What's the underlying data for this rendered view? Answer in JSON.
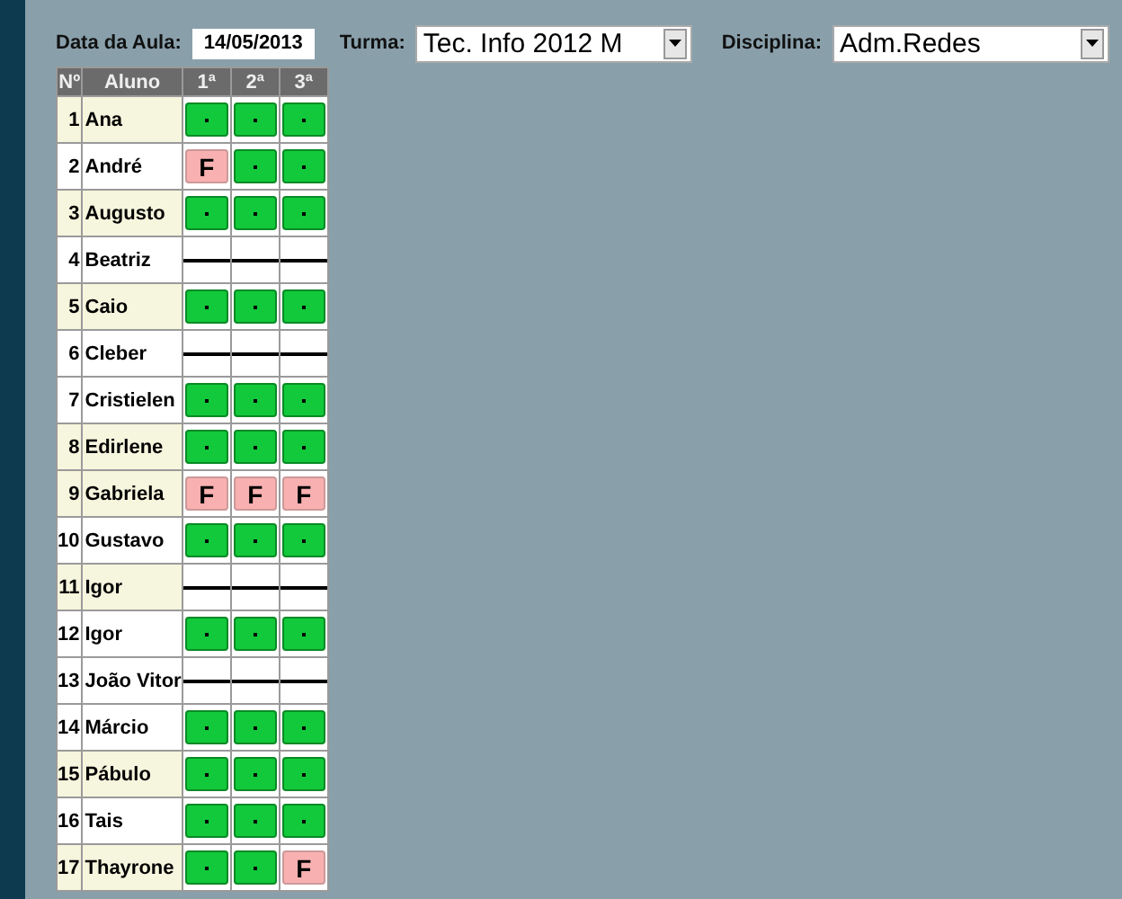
{
  "header": {
    "date_label": "Data da Aula:",
    "date_value": "14/05/2013",
    "class_label": "Turma:",
    "class_value": "Tec. Info 2012 M",
    "subject_label": "Disciplina:",
    "subject_value": "Adm.Redes"
  },
  "table": {
    "columns": [
      "Nº",
      "Aluno",
      "1ª",
      "2ª",
      "3ª"
    ],
    "rows": [
      {
        "number": "1",
        "name": "Ana",
        "shaded": true,
        "marks": [
          {
            "kind": "present"
          },
          {
            "kind": "present"
          },
          {
            "kind": "present"
          }
        ]
      },
      {
        "number": "2",
        "name": "André",
        "shaded": false,
        "marks": [
          {
            "kind": "absent",
            "label": "F"
          },
          {
            "kind": "present"
          },
          {
            "kind": "present"
          }
        ]
      },
      {
        "number": "3",
        "name": "Augusto",
        "shaded": true,
        "marks": [
          {
            "kind": "present"
          },
          {
            "kind": "present"
          },
          {
            "kind": "present"
          }
        ]
      },
      {
        "number": "4",
        "name": "Beatriz",
        "shaded": false,
        "marks": [
          {
            "kind": "none"
          },
          {
            "kind": "none"
          },
          {
            "kind": "none"
          }
        ]
      },
      {
        "number": "5",
        "name": "Caio",
        "shaded": true,
        "marks": [
          {
            "kind": "present"
          },
          {
            "kind": "present"
          },
          {
            "kind": "present"
          }
        ]
      },
      {
        "number": "6",
        "name": "Cleber",
        "shaded": false,
        "marks": [
          {
            "kind": "none"
          },
          {
            "kind": "none"
          },
          {
            "kind": "none"
          }
        ]
      },
      {
        "number": "7",
        "name": "Cristielen",
        "shaded": false,
        "marks": [
          {
            "kind": "present"
          },
          {
            "kind": "present"
          },
          {
            "kind": "present"
          }
        ]
      },
      {
        "number": "8",
        "name": "Edirlene",
        "shaded": true,
        "marks": [
          {
            "kind": "present"
          },
          {
            "kind": "present"
          },
          {
            "kind": "present"
          }
        ]
      },
      {
        "number": "9",
        "name": "Gabriela",
        "shaded": true,
        "marks": [
          {
            "kind": "absent",
            "label": "F"
          },
          {
            "kind": "absent",
            "label": "F"
          },
          {
            "kind": "absent",
            "label": "F"
          }
        ]
      },
      {
        "number": "10",
        "name": "Gustavo",
        "shaded": false,
        "marks": [
          {
            "kind": "present"
          },
          {
            "kind": "present"
          },
          {
            "kind": "present"
          }
        ]
      },
      {
        "number": "11",
        "name": "Igor",
        "shaded": true,
        "marks": [
          {
            "kind": "none"
          },
          {
            "kind": "none"
          },
          {
            "kind": "none"
          }
        ]
      },
      {
        "number": "12",
        "name": "Igor",
        "shaded": false,
        "marks": [
          {
            "kind": "present"
          },
          {
            "kind": "present"
          },
          {
            "kind": "present"
          }
        ]
      },
      {
        "number": "13",
        "name": "João Vitor",
        "shaded": false,
        "marks": [
          {
            "kind": "none"
          },
          {
            "kind": "none"
          },
          {
            "kind": "none"
          }
        ]
      },
      {
        "number": "14",
        "name": "Márcio",
        "shaded": false,
        "marks": [
          {
            "kind": "present"
          },
          {
            "kind": "present"
          },
          {
            "kind": "present"
          }
        ]
      },
      {
        "number": "15",
        "name": "Pábulo",
        "shaded": true,
        "marks": [
          {
            "kind": "present"
          },
          {
            "kind": "present"
          },
          {
            "kind": "present"
          }
        ]
      },
      {
        "number": "16",
        "name": "Tais",
        "shaded": false,
        "marks": [
          {
            "kind": "present"
          },
          {
            "kind": "present"
          },
          {
            "kind": "present"
          }
        ]
      },
      {
        "number": "17",
        "name": "Thayrone",
        "shaded": true,
        "marks": [
          {
            "kind": "present"
          },
          {
            "kind": "present"
          },
          {
            "kind": "absent",
            "label": "F"
          }
        ]
      }
    ]
  }
}
